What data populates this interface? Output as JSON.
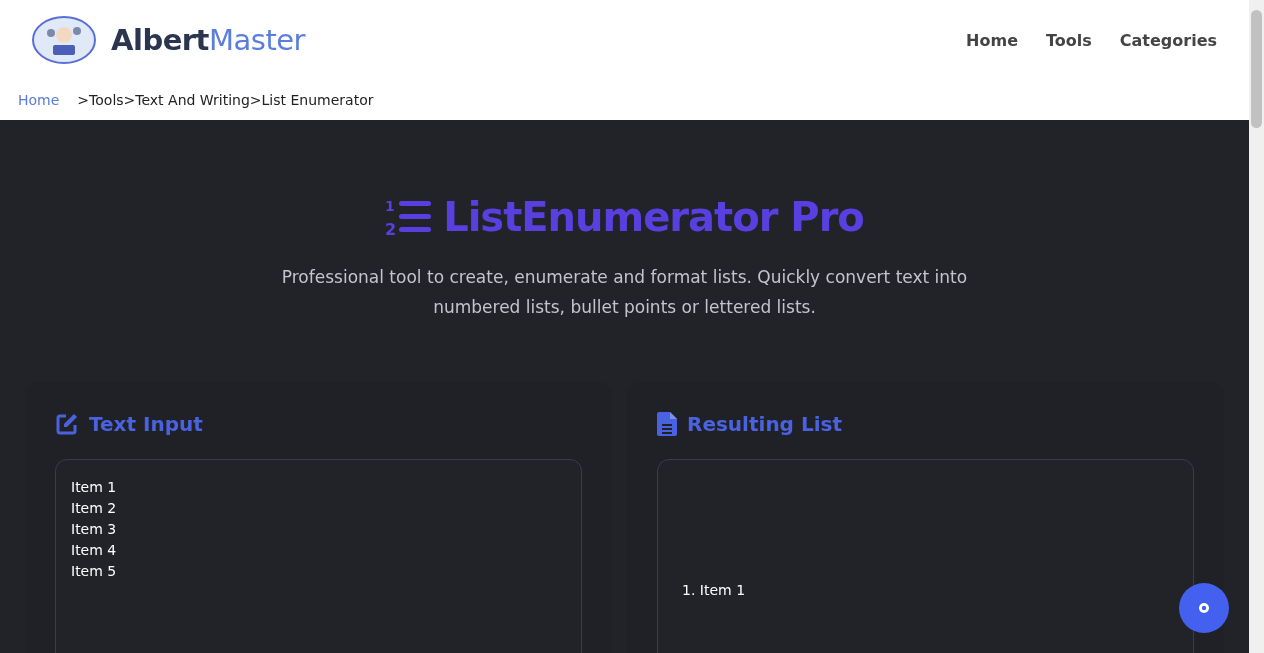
{
  "header": {
    "logo_text_dark": "Albert",
    "logo_text_light": "Master",
    "nav": [
      "Home",
      "Tools",
      "Categories"
    ]
  },
  "breadcrumb": {
    "home": "Home",
    "items": [
      ">Tools",
      ">Text And Writing",
      ">List Enumerator"
    ]
  },
  "hero": {
    "icon_numbers": [
      "1",
      "2"
    ],
    "title": "ListEnumerator Pro",
    "description": "Professional tool to create, enumerate and format lists. Quickly convert text into numbered lists, bullet points or lettered lists."
  },
  "input_panel": {
    "title": "Text Input",
    "lines": [
      "Item 1",
      "Item 2",
      "Item 3",
      "Item 4",
      "Item 5"
    ]
  },
  "result_panel": {
    "title": "Resulting List",
    "items": [
      "1. Item 1"
    ]
  }
}
